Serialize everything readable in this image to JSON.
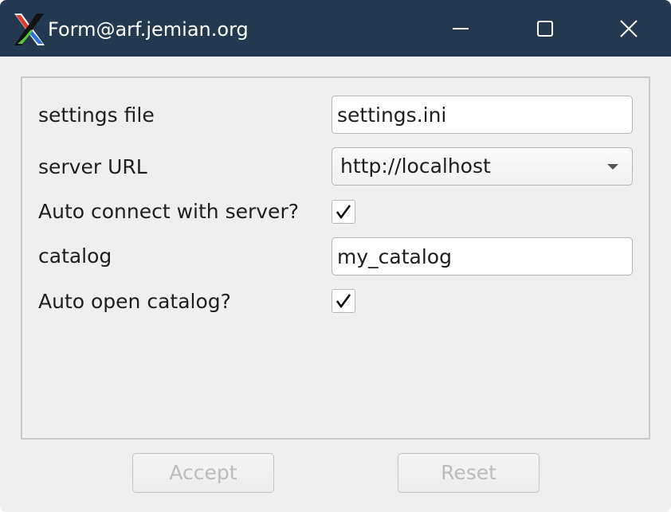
{
  "window": {
    "title": "Form@arf.jemian.org"
  },
  "titlebar": {
    "icons": [
      "x-logo-icon",
      "minimize-icon",
      "maximize-icon",
      "close-icon"
    ]
  },
  "form": {
    "settings_file": {
      "label": "settings file",
      "value": "settings.ini"
    },
    "server_url": {
      "label": "server URL",
      "value": "http://localhost"
    },
    "auto_connect": {
      "label": "Auto connect with server?",
      "checked": true
    },
    "catalog": {
      "label": "catalog",
      "value": "my_catalog"
    },
    "auto_open": {
      "label": "Auto open catalog?",
      "checked": true
    }
  },
  "buttons": {
    "accept_label": "Accept",
    "reset_label": "Reset",
    "enabled": false
  },
  "colors": {
    "titlebar": "#24394f",
    "window_bg": "#efefef",
    "disabled_text": "#bcbcbc"
  }
}
